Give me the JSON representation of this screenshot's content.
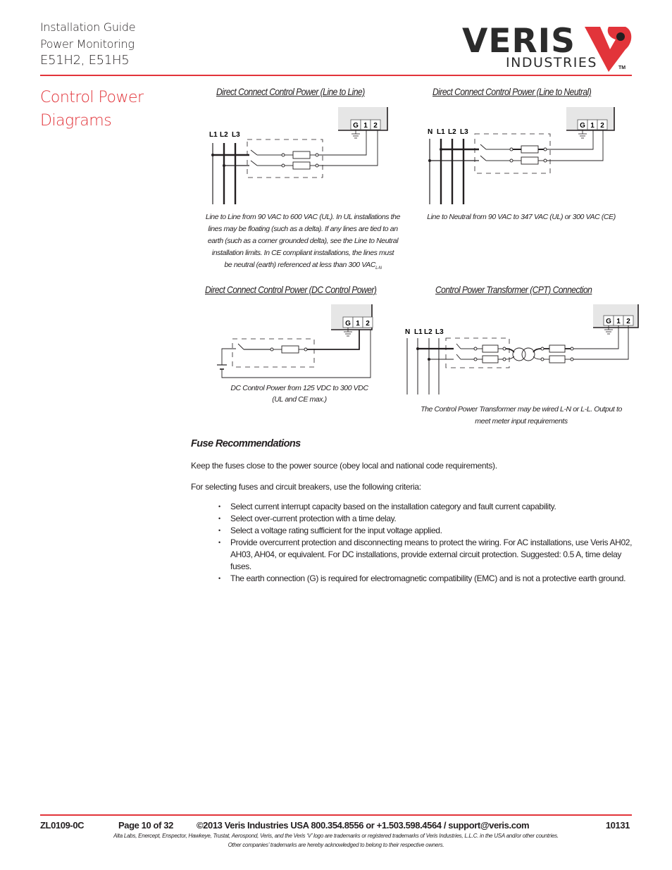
{
  "header": {
    "line1": "Installation Guide",
    "line2": "Power Monitoring",
    "line3": "E51H2, E51H5",
    "logo": {
      "brand": "VERIS",
      "sub": "INDUSTRIES",
      "tm": "TM",
      "accent_color": "#e2343a"
    }
  },
  "section": {
    "title_line1": "Control Power",
    "title_line2": "Diagrams"
  },
  "diagrams": [
    {
      "title": "Direct Connect Control Power (Line to Line)",
      "lines": [
        "L1",
        "L2",
        "L3"
      ],
      "terminals": [
        "G",
        "1",
        "2"
      ],
      "caption_lines": [
        "Line to Line  from 90 VAC to 600 VAC (UL). In UL installations the",
        "lines may be floating (such as a delta). If any lines are tied to an",
        "earth (such as a corner grounded delta), see the Line to Neutral",
        "installation limits. In CE compliant installations, the lines must",
        "be neutral (earth) referenced at less than 300 VAC"
      ],
      "caption_subscript": "L-N"
    },
    {
      "title": "Direct Connect Control Power (Line to Neutral)",
      "lines": [
        "N",
        "L1",
        "L2",
        "L3"
      ],
      "terminals": [
        "G",
        "1",
        "2"
      ],
      "caption": "Line to Neutral from 90 VAC to 347 VAC (UL) or 300 VAC (CE)"
    },
    {
      "title": "Direct Connect Control Power (DC Control Power)",
      "terminals": [
        "G",
        "1",
        "2"
      ],
      "caption_line1": "DC Control Power from 125 VDC to 300 VDC",
      "caption_line2": "(UL and CE max.)"
    },
    {
      "title": "Control Power Transformer (CPT) Connection",
      "lines": [
        "N",
        "L1",
        "L2",
        "L3"
      ],
      "terminals": [
        "G",
        "1",
        "2"
      ],
      "caption_line1": "The Control Power Transformer may be wired L-N or L-L. Output to",
      "caption_line2": "meet meter input requirements"
    }
  ],
  "fuse": {
    "title": "Fuse Recommendations",
    "para1": "Keep the fuses close to the power source (obey local and national code requirements).",
    "para2": "For selecting fuses and circuit breakers, use the following criteria:",
    "bullets": [
      "Select current interrupt capacity based on the installation category and fault current capability.",
      "Select over-current protection with a time delay.",
      "Select a voltage rating sufficient for the input voltage applied.",
      "Provide overcurrent protection and disconnecting means to protect the wiring. For AC installations, use Veris AH02,",
      "AH03, AH04, or equivalent. For DC installations, provide external circuit protection. Suggested: 0.5 A, time delay fuses.",
      "The earth connection (G) is required for electromagnetic compatibility (EMC) and is not a protective earth ground."
    ]
  },
  "footer": {
    "doc_id": "ZL0109-0C",
    "page": "Page 10 of 32",
    "copyright": "©2013 Veris Industries   USA 800.354.8556 or +1.503.598.4564  / support@veris.com",
    "code": "10131",
    "trademark1": "Alta Labs, Enercept, Enspector, Hawkeye, Trustat, Aerospond, Veris, and the Veris ‘V’ logo are trademarks or registered trademarks of  Veris Industries, L.L.C. in the USA and/or other countries.",
    "trademark2": "Other companies’ trademarks are hereby acknowledged to belong to their respective owners."
  }
}
